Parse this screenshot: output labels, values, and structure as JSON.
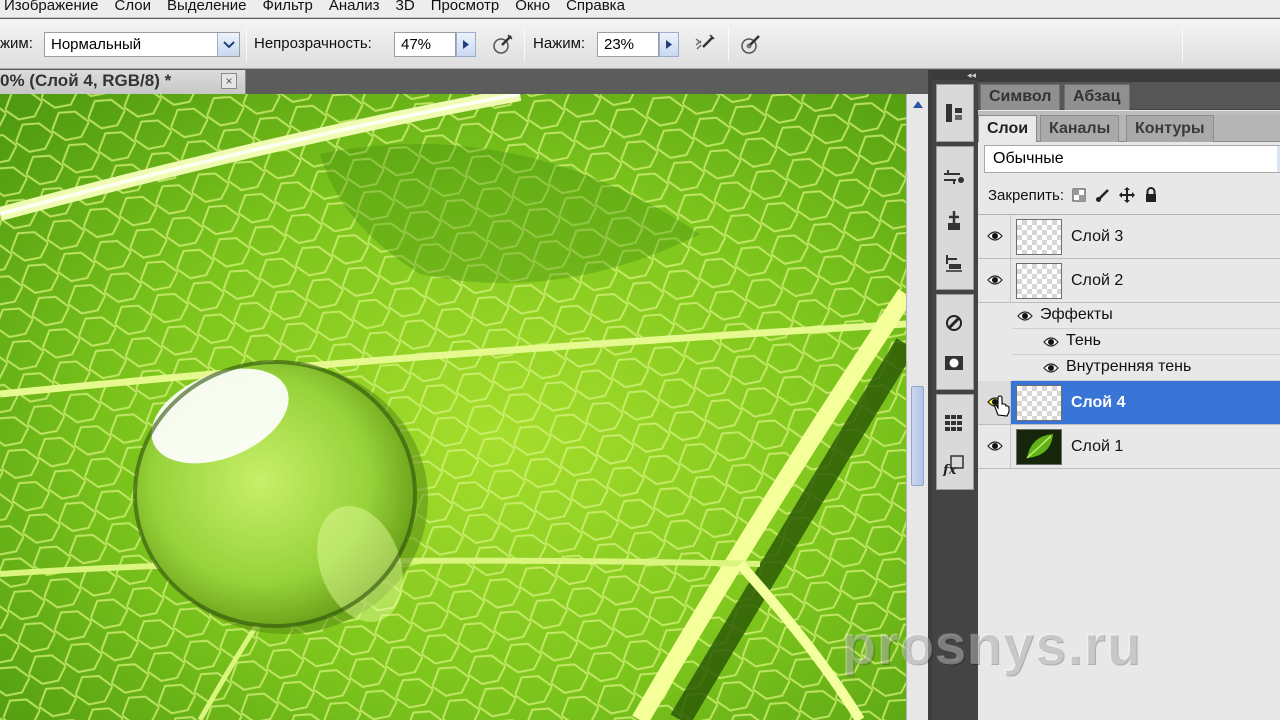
{
  "menu": {
    "items": [
      "Изображение",
      "Слои",
      "Выделение",
      "Фильтр",
      "Анализ",
      "3D",
      "Просмотр",
      "Окно",
      "Справка"
    ]
  },
  "options": {
    "mode_label": "жим:",
    "mode_value": "Нормальный",
    "opacity_label": "Непрозрачность:",
    "opacity_value": "47%",
    "pressure_label": "Нажим:",
    "pressure_value": "23%"
  },
  "document": {
    "tab_title": "0% (Слой 4, RGB/8) *",
    "close_symbol": "×"
  },
  "panels": {
    "collapse_symbol": "◂◂",
    "tabs_top": [
      "Символ",
      "Абзац"
    ],
    "tabs_layers": [
      "Слои",
      "Каналы",
      "Контуры"
    ],
    "blend_mode": "Обычные",
    "lock_label": "Закрепить:",
    "layers": [
      {
        "name": "Слой 3",
        "visible": true,
        "selected": false
      },
      {
        "name": "Слой 2",
        "visible": true,
        "selected": false,
        "effects_label": "Эффекты",
        "effects": [
          "Тень",
          "Внутренняя тень"
        ]
      },
      {
        "name": "Слой 4",
        "visible": true,
        "selected": true
      },
      {
        "name": "Слой 1",
        "visible": true,
        "selected": false
      }
    ]
  },
  "icons": {
    "eye": "eye-icon",
    "lock_transparent": "lock-transparency-icon",
    "lock_image": "lock-brush-icon",
    "lock_position": "lock-move-icon",
    "lock_all": "lock-all-icon"
  },
  "colors": {
    "selection": "#3875d7",
    "leaf": "#7fc31b"
  },
  "watermark": "prosnys.ru"
}
